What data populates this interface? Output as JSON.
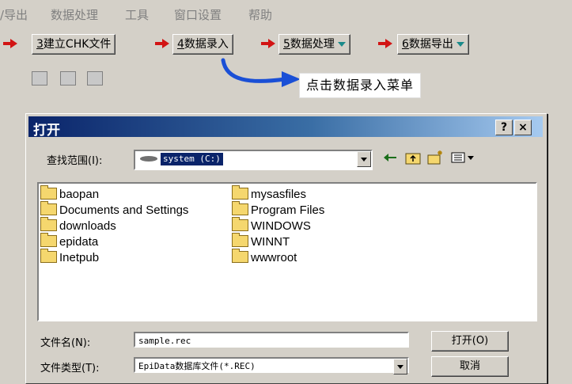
{
  "menu": [
    "/导出",
    "数据处理",
    "工具",
    "窗口设置",
    "帮助"
  ],
  "toolbar": {
    "buttons": [
      {
        "num": "3",
        "label": "建立CHK文件"
      },
      {
        "num": "4",
        "label": "数据录入"
      },
      {
        "num": "5",
        "label": "数据处理"
      },
      {
        "num": "6",
        "label": "数据导出"
      }
    ]
  },
  "callout": "点击数据录入菜单",
  "dialog": {
    "title": "打开",
    "help_btn": "?",
    "close_btn": "×",
    "lookin_label": "查找范围(I):",
    "lookin_value": "system (C:)",
    "files": [
      "baopan",
      "Documents and Settings",
      "downloads",
      "epidata",
      "Inetpub",
      "mysasfiles",
      "Program Files",
      "WINDOWS",
      "WINNT",
      "wwwroot"
    ],
    "filename_label": "文件名(N):",
    "filename_value": "sample.rec",
    "filetype_label": "文件类型(T):",
    "filetype_value": "EpiData数据库文件(*.REC)",
    "open_btn": "打开(O)",
    "cancel_btn": "取消"
  },
  "colors": {
    "accent": "#0a246a",
    "arrow_red": "#d21414",
    "arrow_blue": "#1a4fd6"
  }
}
